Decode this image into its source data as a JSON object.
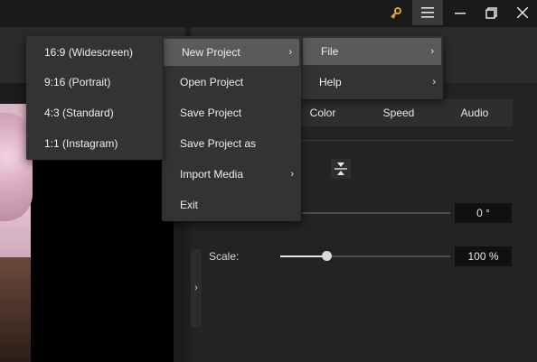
{
  "titlebar": {
    "key_icon": "key-icon",
    "menu_icon": "hamburger-menu-icon",
    "min_icon": "minimize-icon",
    "max_icon": "restore-icon",
    "close_icon": "close-icon"
  },
  "menus": {
    "file_menu": [
      {
        "label": "File",
        "has_submenu": true,
        "highlighted": true
      },
      {
        "label": "Help",
        "has_submenu": true,
        "highlighted": false
      }
    ],
    "main_menu": [
      {
        "label": "New Project",
        "has_submenu": true,
        "highlighted": true
      },
      {
        "label": "Open Project",
        "has_submenu": false,
        "highlighted": false
      },
      {
        "label": "Save Project",
        "has_submenu": false,
        "highlighted": false
      },
      {
        "label": "Save Project as",
        "has_submenu": false,
        "highlighted": false
      },
      {
        "label": "Import Media",
        "has_submenu": true,
        "highlighted": false
      },
      {
        "label": "Exit",
        "has_submenu": false,
        "highlighted": false
      }
    ],
    "new_project_menu": [
      {
        "label": "16:9 (Widescreen)"
      },
      {
        "label": "9:16 (Portrait)"
      },
      {
        "label": "4:3 (Standard)"
      },
      {
        "label": "1:1 (Instagram)"
      }
    ],
    "submenu_arrow": "›"
  },
  "tabs": [
    {
      "label": "Color"
    },
    {
      "label": "Speed"
    },
    {
      "label": "Audio"
    }
  ],
  "properties": {
    "rotation_value": "0 °",
    "scale_label": "Scale:",
    "scale_value": "100 %",
    "scale_fraction": 0.28
  },
  "colors": {
    "menu_bg": "#333333",
    "menu_highlight": "#5a5a5a",
    "key_icon": "#e0a52a"
  }
}
